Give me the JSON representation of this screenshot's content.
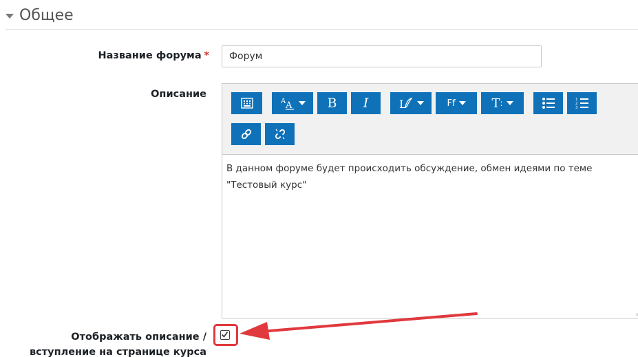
{
  "section": {
    "title": "Общее",
    "collapse_icon": "triangle-down-icon"
  },
  "forum_name": {
    "label": "Название форума",
    "required_mark": "*",
    "value": "Форум"
  },
  "description": {
    "label": "Описание",
    "toolbar": [
      {
        "name": "toolbar-toggle",
        "icon": "keyboard-icon"
      },
      {
        "name": "font-size",
        "icon": "font-size-icon",
        "dropdown": true
      },
      {
        "name": "bold",
        "text": "B"
      },
      {
        "name": "italic",
        "text": "I"
      },
      {
        "name": "paragraph-styles",
        "icon": "text-style-icon",
        "dropdown": true
      },
      {
        "name": "font-family",
        "text": "Ff",
        "dropdown": true
      },
      {
        "name": "text-format",
        "text": "T",
        "dropdown": true
      },
      {
        "name": "unordered-list",
        "icon": "bullet-list-icon"
      },
      {
        "name": "ordered-list",
        "icon": "numbered-list-icon"
      },
      {
        "name": "link",
        "icon": "link-icon"
      },
      {
        "name": "unlink",
        "icon": "unlink-icon"
      }
    ],
    "content_line1": "В данном форуме будет происходить обсуждение, обмен идеями по теме",
    "content_line2": "\"Тестовый курс\""
  },
  "show_description": {
    "label_line1": "Отображать описание /",
    "label_line2": "вступление на странице курса",
    "checked": true
  },
  "colors": {
    "toolbar_button": "#0f72b9",
    "required": "#c9302c",
    "highlight": "#e0393e"
  }
}
